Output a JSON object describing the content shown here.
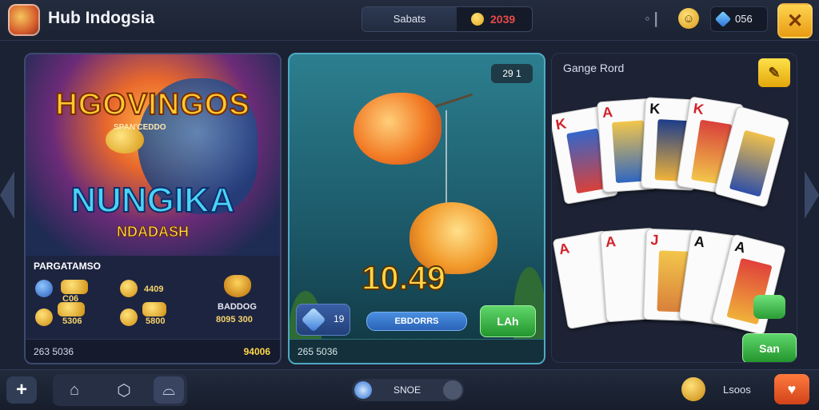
{
  "header": {
    "app_title": "Hub Indogsia",
    "pill_left": "Sabats",
    "pill_right_value": "2039",
    "stats_icon": "◦❘",
    "gem_value": "056",
    "close_icon": "✕"
  },
  "panel_slots": {
    "title_top": "HGOVINGOS",
    "subtitle_top": "SPAN'CEDDO",
    "title_main": "NUNGIKA",
    "subtitle_main": "NDADASH",
    "section_label": "PARGATAMSO",
    "rewards": [
      {
        "value": "C06"
      },
      {
        "value": "4409"
      },
      {
        "value": "5306"
      },
      {
        "value": "5800"
      },
      {
        "value": "BADDOG"
      },
      {
        "value": "8095 300"
      }
    ],
    "footer_left": "263 5036",
    "footer_right": "94006"
  },
  "panel_fishing": {
    "badge": "29 1",
    "big_number": "10.49",
    "ctrl_left_label": "19",
    "ctrl_center_label": "EBDORRS",
    "ctrl_right_label": "LAh",
    "footer_text": "265 5036"
  },
  "panel_cards": {
    "title": "Gange Rord",
    "pin_icon": "✎",
    "top_cards": [
      {
        "rank": "K",
        "suit": "♠"
      },
      {
        "rank": "A",
        "suit": "♥"
      },
      {
        "rank": "K",
        "suit": "♠"
      },
      {
        "rank": "K",
        "suit": "♥"
      },
      {
        "rank": "",
        "suit": "♠"
      }
    ],
    "bottom_cards": [
      {
        "rank": "A",
        "suit": "♥"
      },
      {
        "rank": "A",
        "suit": "♥"
      },
      {
        "rank": "J",
        "suit": "♥"
      },
      {
        "rank": "A",
        "suit": "♠"
      },
      {
        "rank": "A",
        "suit": "♠"
      }
    ],
    "action_button": "San"
  },
  "bottombar": {
    "plus_icon": "+",
    "home_icon": "⌂",
    "box_icon": "⬡",
    "user_icon": "⌓",
    "toggle_label": "SNOE",
    "right_label": "Lsoos",
    "heart_icon": "♥"
  },
  "colors": {
    "accent_gold": "#ffd64a",
    "accent_green": "#23962e",
    "accent_red": "#e74a4a"
  }
}
